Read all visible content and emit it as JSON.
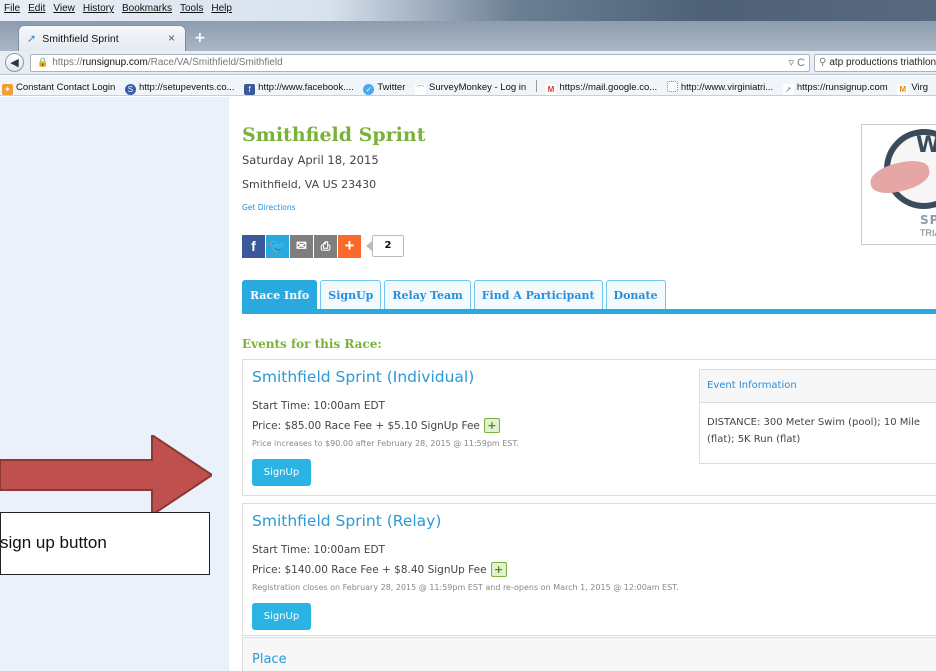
{
  "browser": {
    "menu": [
      "File",
      "Edit",
      "View",
      "History",
      "Bookmarks",
      "Tools",
      "Help"
    ],
    "tab_title": "Smithfield Sprint",
    "url_prefix": "https://",
    "url_domain": "runsignup.com",
    "url_path": "/Race/VA/Smithfield/Smithfield",
    "search_value": "atp productions triathlon",
    "bookmarks": [
      "Constant Contact Login",
      "http://setupevents.co...",
      "http://www.facebook....",
      "Twitter",
      "SurveyMonkey - Log in",
      "https://mail.google.co...",
      "http://www.virginiatri...",
      "https://runsignup.com",
      "Virg"
    ]
  },
  "race": {
    "title": "Smithfield Sprint",
    "date": "Saturday April 18, 2015",
    "location": "Smithfield, VA US 23430",
    "directions": "Get Directions",
    "share_count": "2",
    "logo_letters": {
      "w": "W",
      "spr": "SPR",
      "tri": "TRIATH"
    }
  },
  "tabs": [
    "Race Info",
    "SignUp",
    "Relay Team",
    "Find A Participant",
    "Donate"
  ],
  "events_heading": "Events for this Race:",
  "events": [
    {
      "name": "Smithfield Sprint (Individual)",
      "start": "Start Time: 10:00am EDT",
      "price": "Price: $85.00 Race Fee + $5.10 SignUp Fee",
      "note": "Price increases to $90.00 after February 28, 2015 @ 11:59pm EST.",
      "button": "SignUp",
      "info_header": "Event Information",
      "info_line1": "DISTANCE: 300 Meter Swim (pool); 10 Mile",
      "info_line2": "(flat); 5K Run (flat)"
    },
    {
      "name": "Smithfield Sprint (Relay)",
      "start": "Start Time: 10:00am EDT",
      "price": "Price: $140.00 Race Fee + $8.40 SignUp Fee",
      "note": "Registration closes on February 28, 2015 @ 11:59pm EST and re-opens on March 1, 2015 @ 12:00am EST.",
      "button": "SignUp"
    }
  ],
  "place_label": "Place",
  "annotation": "sign up button",
  "colors": {
    "accent_green": "#79b23a",
    "accent_blue": "#2aa8e0",
    "arrow": "#c0504d"
  }
}
